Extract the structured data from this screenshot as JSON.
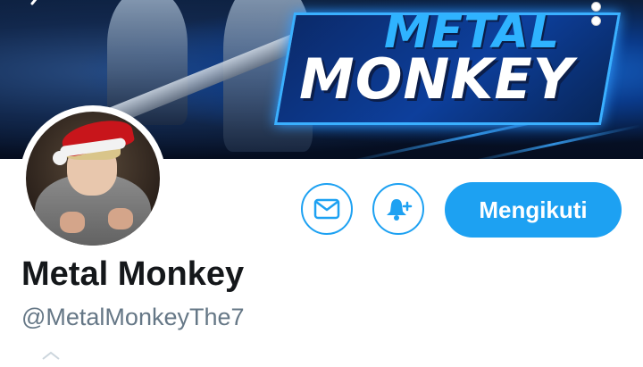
{
  "banner": {
    "logo_line1": "METAL",
    "logo_line2": "MONKEY",
    "accent_color": "#2fb3ff"
  },
  "nav": {
    "back_icon": "chevron-left-icon",
    "more_icon": "more-vertical-icon"
  },
  "profile": {
    "display_name": "Metal Monkey",
    "handle": "@MetalMonkeyThe7"
  },
  "actions": {
    "message_icon": "envelope-icon",
    "notify_icon": "bell-plus-icon",
    "follow_label": "Mengikuti",
    "brand_color": "#1da1f2"
  }
}
